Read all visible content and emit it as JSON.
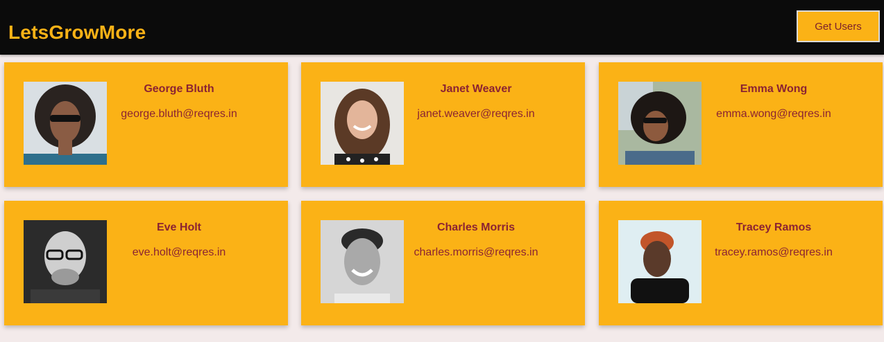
{
  "header": {
    "brand": "LetsGrowMore",
    "get_users_label": "Get Users"
  },
  "colors": {
    "nav_background": "#0b0b0b",
    "accent": "#fbb216",
    "card_text": "#8b2332",
    "page_background": "#f3eaea"
  },
  "users": [
    {
      "name": "George Bluth",
      "email": "george.bluth@reqres.in"
    },
    {
      "name": "Janet Weaver",
      "email": "janet.weaver@reqres.in"
    },
    {
      "name": "Emma Wong",
      "email": "emma.wong@reqres.in"
    },
    {
      "name": "Eve Holt",
      "email": "eve.holt@reqres.in"
    },
    {
      "name": "Charles Morris",
      "email": "charles.morris@reqres.in"
    },
    {
      "name": "Tracey Ramos",
      "email": "tracey.ramos@reqres.in"
    }
  ]
}
